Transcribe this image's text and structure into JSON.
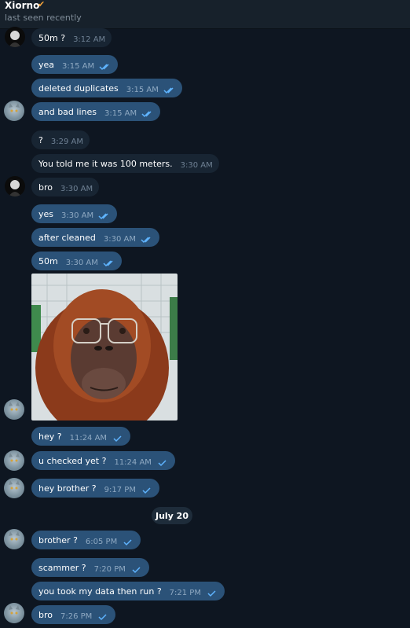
{
  "header": {
    "name": "Xiorno",
    "status": "last seen recently"
  },
  "date_separator": "July 20",
  "messages": [
    {
      "text": "50m ?",
      "time": "3:12 AM",
      "dir": "in"
    },
    {
      "text": "yea",
      "time": "3:15 AM",
      "dir": "out",
      "read": "double"
    },
    {
      "text": "deleted duplicates",
      "time": "3:15 AM",
      "dir": "out",
      "read": "double"
    },
    {
      "text": "and bad lines",
      "time": "3:15 AM",
      "dir": "out",
      "read": "double"
    },
    {
      "text": "?",
      "time": "3:29 AM",
      "dir": "in"
    },
    {
      "text": "You told me it was 100 meters.",
      "time": "3:30 AM",
      "dir": "in"
    },
    {
      "text": "bro",
      "time": "3:30 AM",
      "dir": "in"
    },
    {
      "text": "yes",
      "time": "3:30 AM",
      "dir": "out",
      "read": "double"
    },
    {
      "text": "after cleaned",
      "time": "3:30 AM",
      "dir": "out",
      "read": "double"
    },
    {
      "text": "50m",
      "time": "3:30 AM",
      "dir": "out",
      "read": "double"
    },
    {
      "text": "hey ?",
      "time": "11:24 AM",
      "dir": "out",
      "read": "single"
    },
    {
      "text": "u checked yet ?",
      "time": "11:24 AM",
      "dir": "out",
      "read": "single"
    },
    {
      "text": "hey brother ?",
      "time": "9:17 PM",
      "dir": "out",
      "read": "single"
    },
    {
      "text": "brother ?",
      "time": "6:05 PM",
      "dir": "out",
      "read": "single"
    },
    {
      "text": "scammer ?",
      "time": "7:20 PM",
      "dir": "out",
      "read": "single"
    },
    {
      "text": "you took my data then run ?",
      "time": "7:21 PM",
      "dir": "out",
      "read": "single"
    },
    {
      "text": "bro",
      "time": "7:26 PM",
      "dir": "out",
      "read": "single"
    }
  ],
  "photo": {
    "subject": "orangutan wearing glasses"
  },
  "colors": {
    "background": "#0e1621",
    "header": "#17212b",
    "incoming_bubble": "#182533",
    "outgoing_bubble": "#2b5278",
    "check": "#5fb4ff"
  }
}
